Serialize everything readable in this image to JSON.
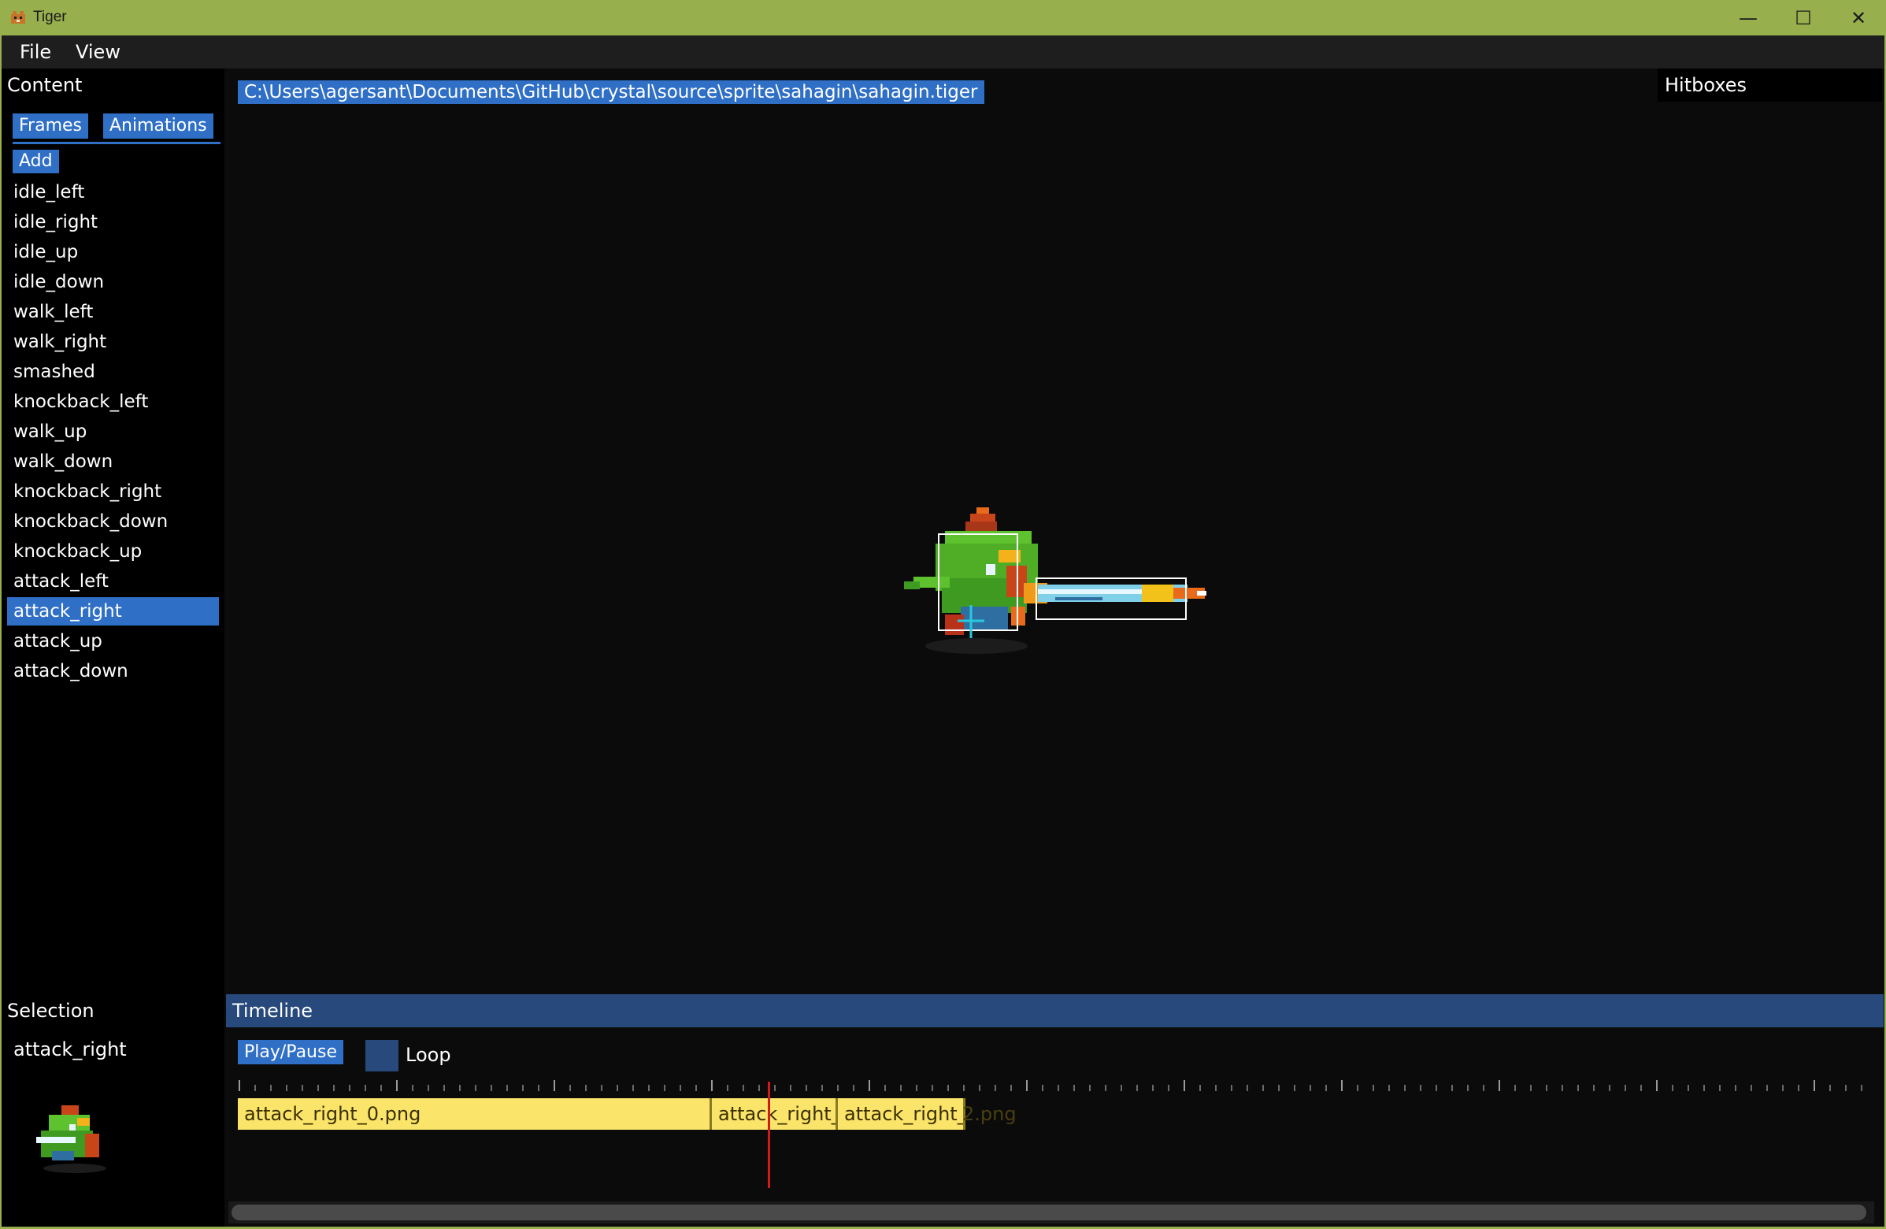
{
  "window": {
    "title": "Tiger",
    "minimize_glyph": "—",
    "maximize_glyph": "☐",
    "close_glyph": "✕"
  },
  "menu": {
    "file": "File",
    "view": "View"
  },
  "content": {
    "header": "Content",
    "tabs": {
      "frames": "Frames",
      "animations": "Animations"
    },
    "add_label": "Add",
    "items": [
      "idle_left",
      "idle_right",
      "idle_up",
      "idle_down",
      "walk_left",
      "walk_right",
      "smashed",
      "knockback_left",
      "walk_up",
      "walk_down",
      "knockback_right",
      "knockback_down",
      "knockback_up",
      "attack_left",
      "attack_right",
      "attack_up",
      "attack_down"
    ],
    "selected_index": 14
  },
  "document": {
    "path": "C:\\Users\\agersant\\Documents\\GitHub\\crystal\\source\\sprite\\sahagin\\sahagin.tiger"
  },
  "hitboxes": {
    "header": "Hitboxes"
  },
  "selection": {
    "header": "Selection",
    "name": "attack_right"
  },
  "timeline": {
    "header": "Timeline",
    "play_pause": "Play/Pause",
    "loop_label": "Loop",
    "frames": [
      "attack_right_0.png",
      "attack_right_",
      "attack_right_"
    ],
    "overflow_text": "2.png"
  },
  "colors": {
    "accent": "#2f6fc6",
    "titlebar": "#98af4d",
    "timeline_header": "#27497c",
    "frame_fill": "#fbe46a",
    "playhead": "#d11a1a"
  }
}
